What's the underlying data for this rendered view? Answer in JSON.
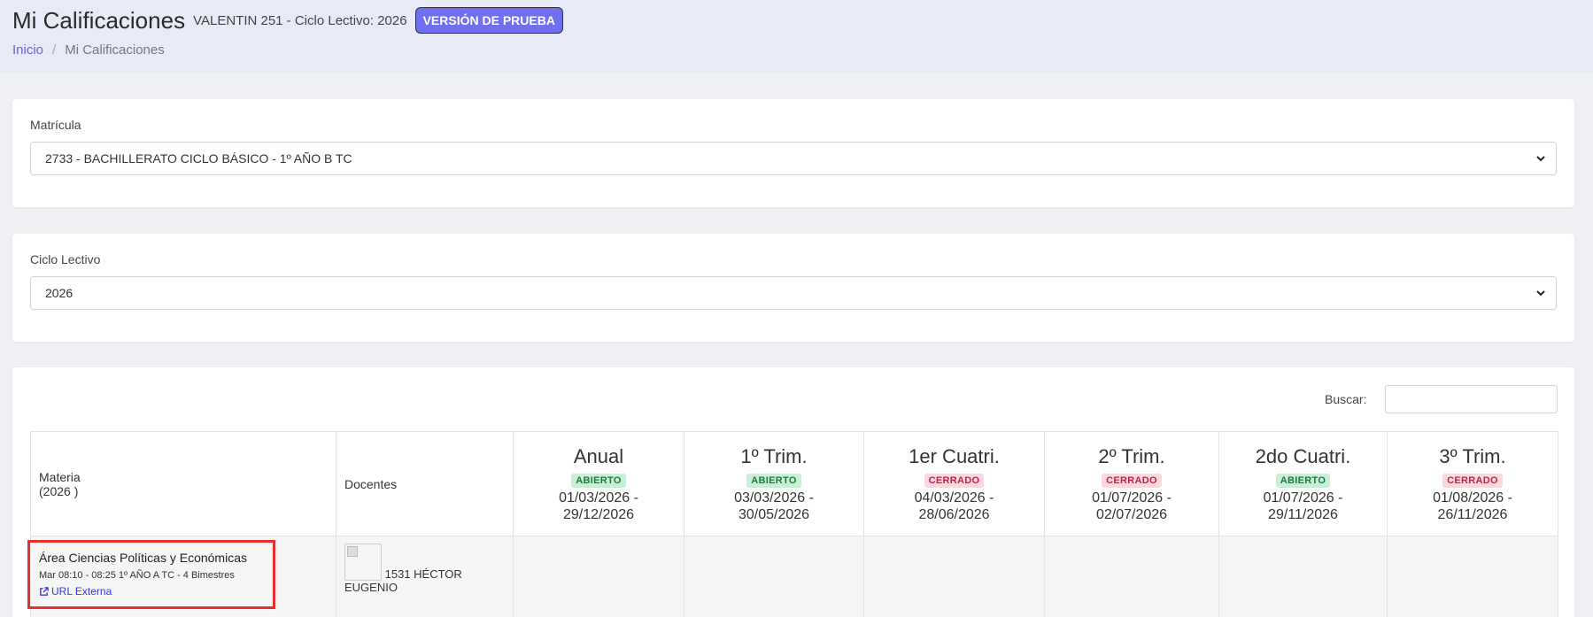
{
  "header": {
    "title": "Mi Calificaciones",
    "subtitle": "VALENTIN 251 - Ciclo Lectivo: 2026",
    "badge": "VERSIÓN DE PRUEBA"
  },
  "breadcrumb": {
    "home": "Inicio",
    "separator": "/",
    "current": "Mi Calificaciones"
  },
  "matricula": {
    "label": "Matrícula",
    "value": "2733 - BACHILLERATO CICLO BÁSICO - 1º AÑO B TC"
  },
  "ciclo": {
    "label": "Ciclo Lectivo",
    "value": "2026"
  },
  "search": {
    "label": "Buscar:",
    "value": ""
  },
  "table": {
    "col_materia": "Materia",
    "col_materia_year": "(2026 )",
    "col_docentes": "Docentes",
    "periods": [
      {
        "name": "Anual",
        "status": "ABIERTO",
        "start": "01/03/2026 -",
        "end": "29/12/2026"
      },
      {
        "name": "1º Trim.",
        "status": "ABIERTO",
        "start": "03/03/2026 -",
        "end": "30/05/2026"
      },
      {
        "name": "1er Cuatri.",
        "status": "CERRADO",
        "start": "04/03/2026 -",
        "end": "28/06/2026"
      },
      {
        "name": "2º Trim.",
        "status": "CERRADO",
        "start": "01/07/2026 -",
        "end": "02/07/2026"
      },
      {
        "name": "2do Cuatri.",
        "status": "ABIERTO",
        "start": "01/07/2026 -",
        "end": "29/11/2026"
      },
      {
        "name": "3º Trim.",
        "status": "CERRADO",
        "start": "01/08/2026 -",
        "end": "26/11/2026"
      }
    ],
    "rows": [
      {
        "materia": "Área Ciencias Políticas y Económicas",
        "detail": "Mar 08:10 - 08:25 1º AÑO A TC - 4 Bimestres",
        "link": "URL Externa",
        "docente_line1": "1531 HÉCTOR",
        "docente_line2": "EUGENIO"
      }
    ]
  },
  "colors": {
    "accent": "#6f6ff0",
    "header_bg": "#e8eaf8",
    "open_bg": "#c8f0d6",
    "closed_bg": "#fbd8e0",
    "highlight_border": "#e53030"
  }
}
